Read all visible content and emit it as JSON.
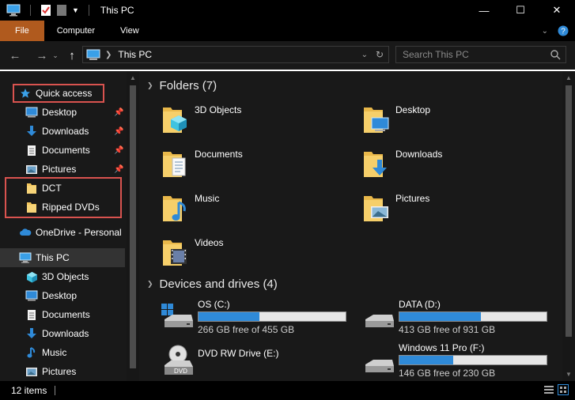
{
  "window": {
    "title": "This PC"
  },
  "ribbon": {
    "tabs": [
      "File",
      "Computer",
      "View"
    ]
  },
  "address": {
    "crumb": "This PC"
  },
  "search": {
    "placeholder": "Search This PC"
  },
  "sidebar": {
    "quick_access": "Quick access",
    "pinned": [
      "Desktop",
      "Downloads",
      "Documents",
      "Pictures"
    ],
    "recent": [
      "DCT",
      "Ripped DVDs"
    ],
    "onedrive": "OneDrive - Personal",
    "this_pc": "This PC",
    "this_pc_children": [
      "3D Objects",
      "Desktop",
      "Documents",
      "Downloads",
      "Music",
      "Pictures"
    ]
  },
  "folders": {
    "header": "Folders (7)",
    "items": [
      "3D Objects",
      "Desktop",
      "Documents",
      "Downloads",
      "Music",
      "Pictures",
      "Videos"
    ]
  },
  "drives": {
    "header": "Devices and drives (4)",
    "items": [
      {
        "name": "OS (C:)",
        "free": "266 GB free of 455 GB",
        "used_fraction": 0.415
      },
      {
        "name": "DATA (D:)",
        "free": "413 GB free of 931 GB",
        "used_fraction": 0.556
      },
      {
        "name": "DVD RW Drive (E:)"
      },
      {
        "name": "Windows 11 Pro (F:)",
        "free": "146 GB free of 230 GB",
        "used_fraction": 0.365
      }
    ]
  },
  "status": {
    "count": "12 items"
  },
  "colors": {
    "accent": "#2f8ad8",
    "file_tab": "#b05a1e",
    "highlight": "#d9534f",
    "folder": "#f2c55c"
  }
}
